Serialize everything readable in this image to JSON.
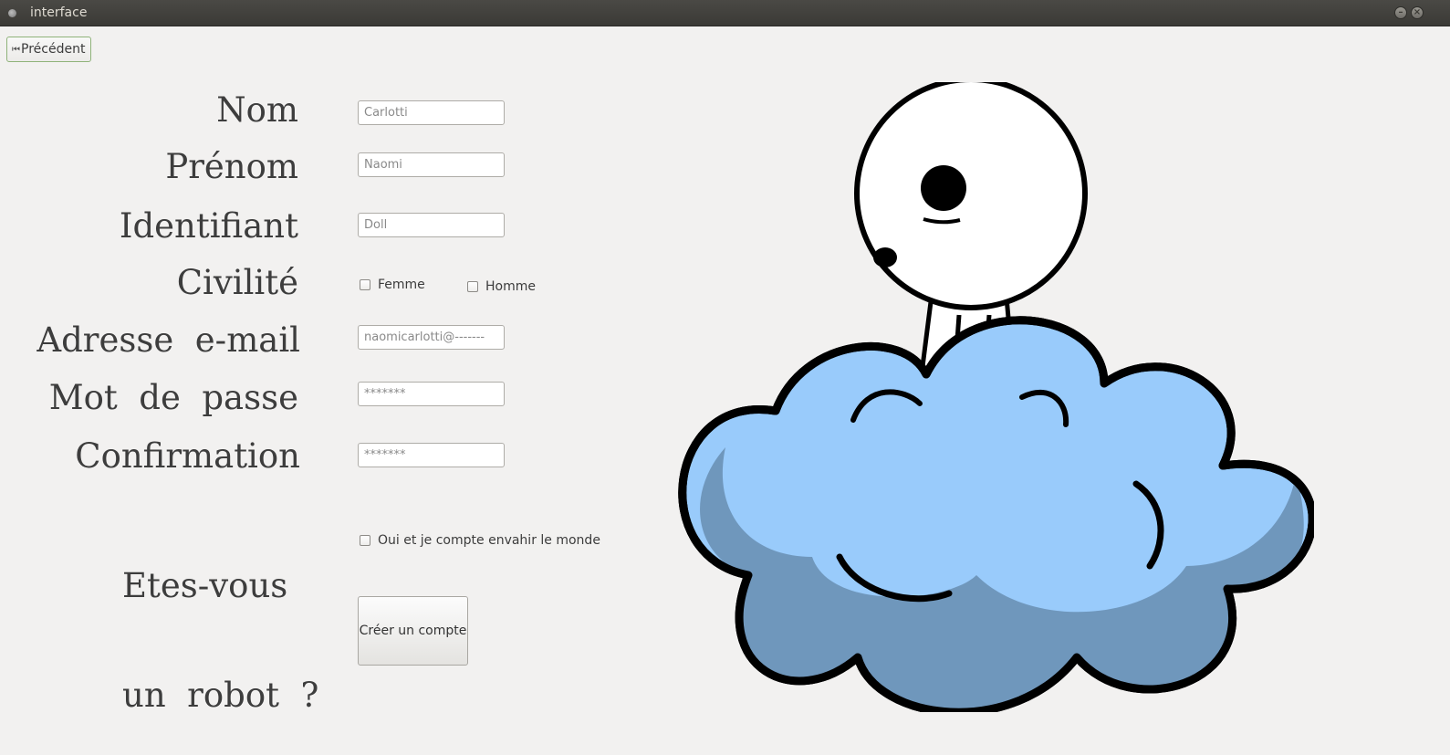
{
  "window": {
    "title": "interface",
    "minimize_glyph": "–",
    "close_glyph": "×"
  },
  "nav": {
    "back_label": "Précédent",
    "back_icon": "⏮"
  },
  "form": {
    "nom": {
      "label": "Nom",
      "placeholder": "Carlotti"
    },
    "prenom": {
      "label": "Prénom",
      "placeholder": "Naomi"
    },
    "identifiant": {
      "label": "Identifiant",
      "placeholder": "Doll"
    },
    "civilite": {
      "label": "Civilité",
      "options": [
        "Femme",
        "Homme"
      ]
    },
    "email": {
      "label": "Adresse  e-mail",
      "placeholder": "naomicarlotti@-------"
    },
    "password": {
      "label": "Mot  de  passe",
      "placeholder": "*******"
    },
    "confirmation": {
      "label": "Confirmation",
      "placeholder": "*******"
    },
    "robot": {
      "label_line1": "Etes-vous",
      "label_line2": "un  robot  ?",
      "checkbox_label": "Oui et je compte envahir le monde"
    },
    "submit_label": "Créer un compte"
  },
  "colors": {
    "background": "#f2f1f0",
    "titlebar": "#3c3b37",
    "label_text": "#3d3d3d",
    "cloud_light": "#99cbfb",
    "cloud_shadow": "#6d93b8",
    "back_border": "#8fb37a"
  },
  "illustration": {
    "name": "character sitting on cloud"
  }
}
